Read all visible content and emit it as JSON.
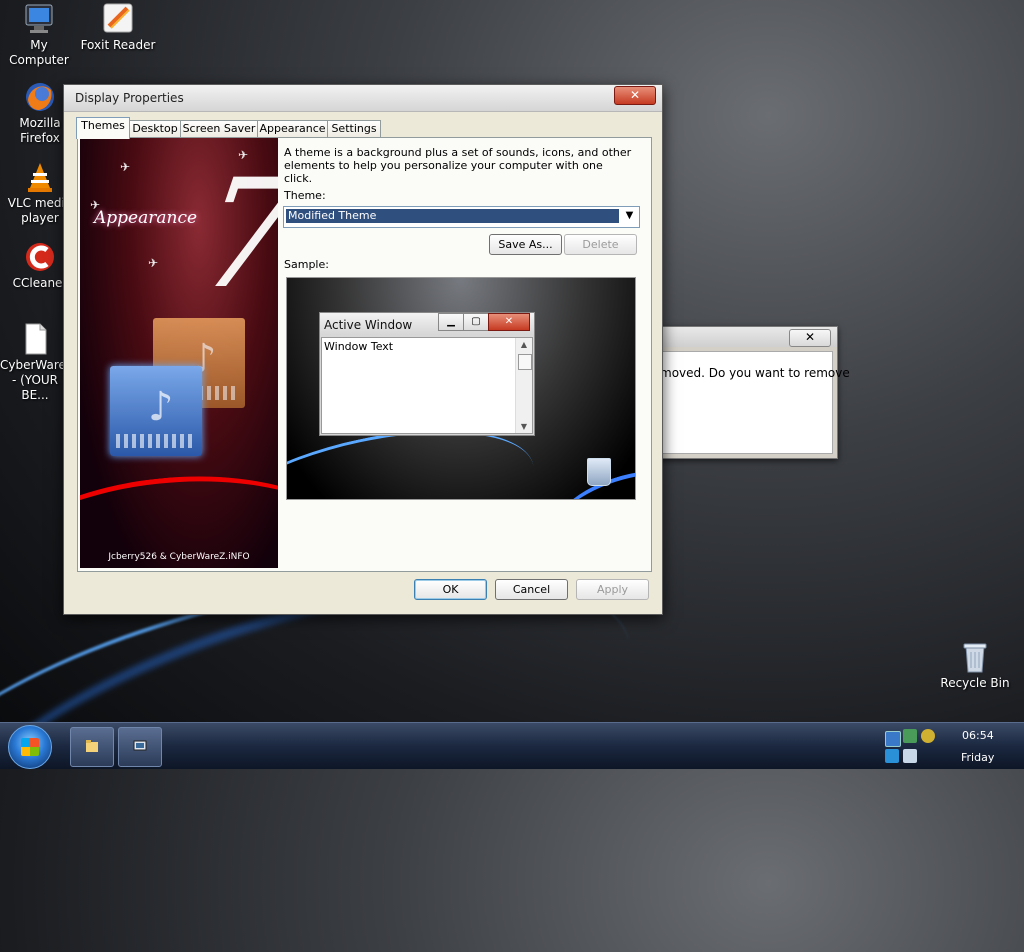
{
  "desktop": {
    "icons": [
      {
        "label": "My Computer",
        "name": "my-computer-icon"
      },
      {
        "label": "Foxit Reader",
        "name": "foxit-reader-icon"
      },
      {
        "label": "Mozilla Firefox",
        "name": "firefox-icon"
      },
      {
        "label": "VLC media player",
        "name": "vlc-icon"
      },
      {
        "label": "CCleaner",
        "name": "ccleaner-icon"
      },
      {
        "label": "CyberWare... - (YOUR BE...",
        "name": "document-icon"
      },
      {
        "label": "Recycle Bin",
        "name": "recycle-bin-icon"
      }
    ]
  },
  "background_dialog": {
    "close_label": "✕",
    "message": "moved.  Do you want to remove"
  },
  "window": {
    "title": "Display Properties",
    "close_label": "✕",
    "tabs": [
      "Themes",
      "Desktop",
      "Screen Saver",
      "Appearance",
      "Settings"
    ],
    "active_tab": "Themes",
    "preview": {
      "appearance_text": "Appearance",
      "credit": "Jcberry526 & CyberWareZ.iNFO"
    },
    "description": "A theme is a background plus a set of sounds, icons, and other elements to help you personalize your computer with one click.",
    "theme_label": "Theme:",
    "theme_value": "Modified Theme",
    "save_as_label": "Save As...",
    "delete_label": "Delete",
    "sample_label": "Sample:",
    "sample": {
      "active_window_title": "Active Window",
      "window_text": "Window Text"
    },
    "ok_label": "OK",
    "cancel_label": "Cancel",
    "apply_label": "Apply"
  },
  "taskbar": {
    "time": "06:54",
    "day": "Friday"
  },
  "colors": {
    "selection": "#2f4f7f",
    "close_red": "#c63a22",
    "taskbar": "#1b2840"
  }
}
